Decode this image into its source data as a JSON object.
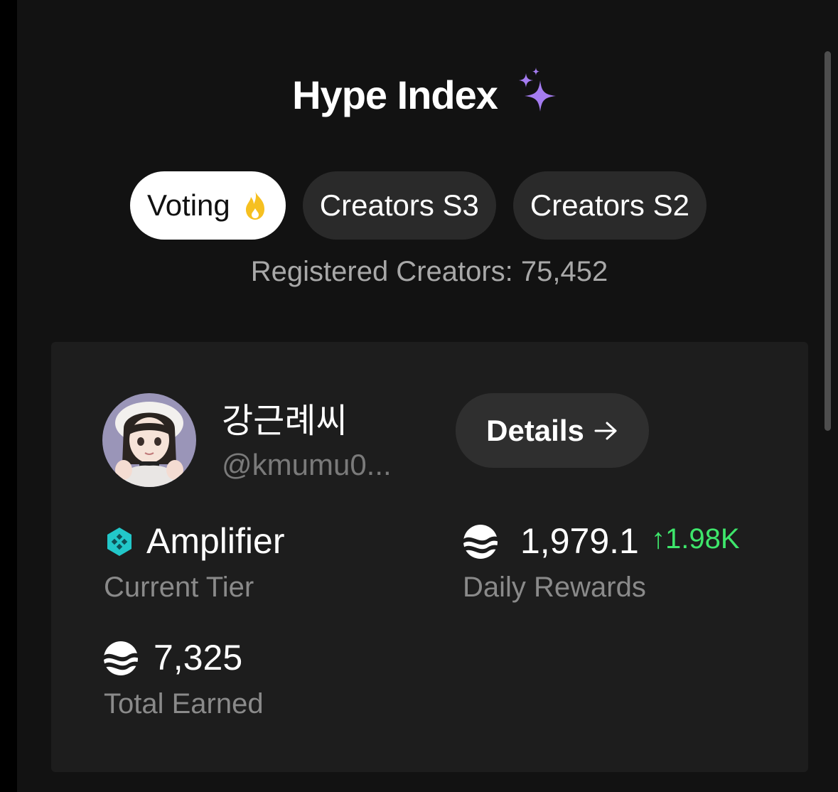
{
  "header": {
    "title": "Hype Index",
    "title_icon": "sparkle-icon"
  },
  "tabs": [
    {
      "label": "Voting",
      "icon": "fire-icon",
      "active": true
    },
    {
      "label": "Creators S3",
      "active": false
    },
    {
      "label": "Creators S2",
      "active": false
    }
  ],
  "registered_text": "Registered Creators: 75,452",
  "profile": {
    "name": "강근례씨",
    "handle": "@kmumu0...",
    "details_label": "Details",
    "details_icon": "arrow-right-icon"
  },
  "stats": {
    "tier_value": "Amplifier",
    "tier_label": "Current Tier",
    "daily_value": "1,979.1",
    "daily_change": "↑1.98K",
    "daily_label": "Daily Rewards",
    "total_value": "7,325",
    "total_label": "Total Earned"
  },
  "colors": {
    "background": "#121212",
    "card": "#1d1d1d",
    "accent_purple": "#9f7aea",
    "positive_green": "#3ee66b",
    "tier_teal": "#22c7c9",
    "fire_yellow": "#f6c020"
  }
}
